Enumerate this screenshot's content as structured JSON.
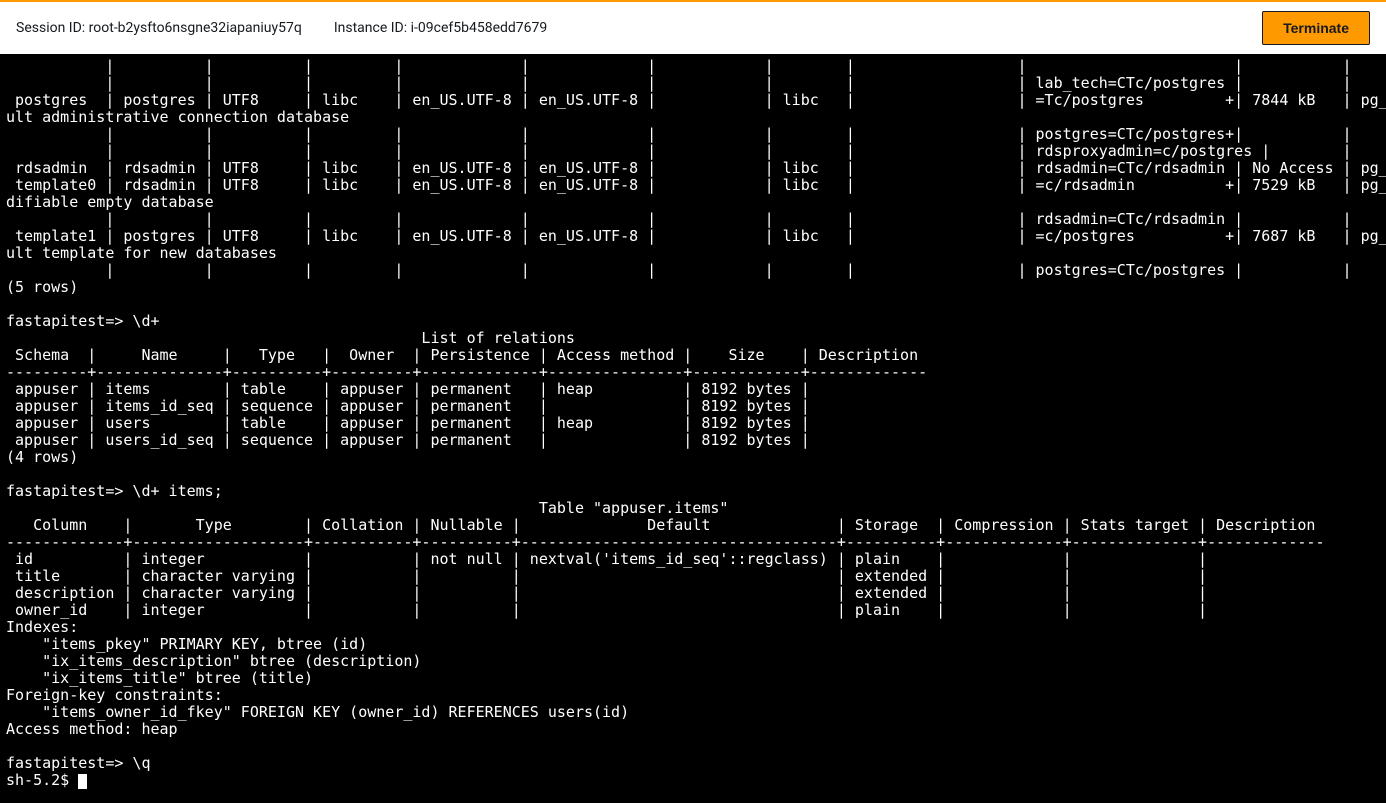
{
  "header": {
    "session_label": "Session ID:",
    "session_id": "root-b2ysfto6nsgne32iapaniuy57q",
    "instance_label": "Instance ID:",
    "instance_id": "i-09cef5b458edd7679",
    "terminate": "Terminate"
  },
  "terminal": {
    "content": "           |          |          |         |             |             |            |        |                  |                       |           |            | \n           |          |          |         |             |             |            |        |                  | lab_tech=CTc/postgres |           |            | \n postgres  | postgres | UTF8     | libc    | en_US.UTF-8 | en_US.UTF-8 |            | libc   |                  | =Tc/postgres         +| 7844 kB   | pg_default | defa\nult administrative connection database\n           |          |          |         |             |             |            |        |                  | postgres=CTc/postgres+|           |            | \n           |          |          |         |             |             |            |        |                  | rdsproxyadmin=c/postgres |        |            | \n rdsadmin  | rdsadmin | UTF8     | libc    | en_US.UTF-8 | en_US.UTF-8 |            | libc   |                  | rdsadmin=CTc/rdsadmin | No Access | pg_default | \n template0 | rdsadmin | UTF8     | libc    | en_US.UTF-8 | en_US.UTF-8 |            | libc   |                  | =c/rdsadmin          +| 7529 kB   | pg_default | unmo\ndifiable empty database\n           |          |          |         |             |             |            |        |                  | rdsadmin=CTc/rdsadmin |           |            | \n template1 | postgres | UTF8     | libc    | en_US.UTF-8 | en_US.UTF-8 |            | libc   |                  | =c/postgres          +| 7687 kB   | pg_default | defa\nult template for new databases\n           |          |          |         |             |             |            |        |                  | postgres=CTc/postgres |           |            | \n(5 rows)\n\nfastapitest=> \\d+\n                                              List of relations\n Schema  |     Name     |   Type   |  Owner  | Persistence | Access method |    Size    | Description \n---------+--------------+----------+---------+-------------+---------------+------------+-------------\n appuser | items        | table    | appuser | permanent   | heap          | 8192 bytes | \n appuser | items_id_seq | sequence | appuser | permanent   |               | 8192 bytes | \n appuser | users        | table    | appuser | permanent   | heap          | 8192 bytes | \n appuser | users_id_seq | sequence | appuser | permanent   |               | 8192 bytes | \n(4 rows)\n\nfastapitest=> \\d+ items;\n                                                           Table \"appuser.items\"\n   Column    |       Type        | Collation | Nullable |              Default              | Storage  | Compression | Stats target | Description \n-------------+-------------------+-----------+----------+-----------------------------------+----------+-------------+--------------+-------------\n id          | integer           |           | not null | nextval('items_id_seq'::regclass) | plain    |             |              | \n title       | character varying |           |          |                                   | extended |             |              | \n description | character varying |           |          |                                   | extended |             |              | \n owner_id    | integer           |           |          |                                   | plain    |             |              | \nIndexes:\n    \"items_pkey\" PRIMARY KEY, btree (id)\n    \"ix_items_description\" btree (description)\n    \"ix_items_title\" btree (title)\nForeign-key constraints:\n    \"items_owner_id_fkey\" FOREIGN KEY (owner_id) REFERENCES users(id)\nAccess method: heap\n\nfastapitest=> \\q\nsh-5.2$ "
  }
}
